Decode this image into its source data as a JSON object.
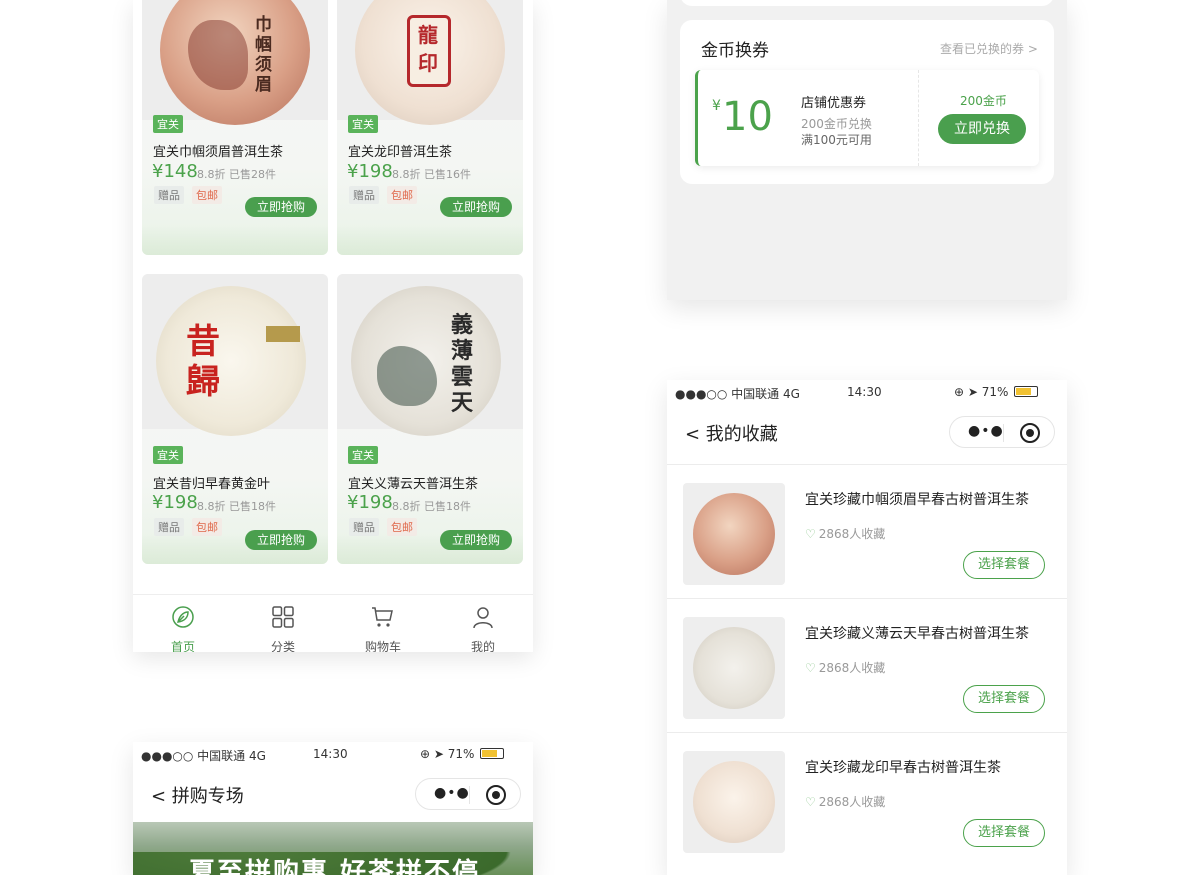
{
  "accent": "#4ba24b",
  "product_grid": {
    "products": [
      {
        "brand": "宜关",
        "name": "宜关巾帼须眉普洱生茶",
        "price": "¥148",
        "meta": "8.8折 已售28件",
        "gift": "赠品",
        "ship": "包邮",
        "buy": "立即抢购",
        "art": "巾帼须眉"
      },
      {
        "brand": "宜关",
        "name": "宜关龙印普洱生茶",
        "price": "¥198",
        "meta": "8.8折 已售16件",
        "gift": "赠品",
        "ship": "包邮",
        "buy": "立即抢购",
        "art": "龍印"
      },
      {
        "brand": "宜关",
        "name": "宜关昔归早春黄金叶",
        "price": "¥198",
        "meta": "8.8折 已售18件",
        "gift": "赠品",
        "ship": "包邮",
        "buy": "立即抢购",
        "art": "昔歸"
      },
      {
        "brand": "宜关",
        "name": "宜关义薄云天普洱生茶",
        "price": "¥198",
        "meta": "8.8折 已售18件",
        "gift": "赠品",
        "ship": "包邮",
        "buy": "立即抢购",
        "art": "義薄雲天"
      }
    ],
    "tabbar": [
      {
        "label": "首页",
        "icon": "leaf-icon",
        "active": true
      },
      {
        "label": "分类",
        "icon": "grid-icon",
        "active": false
      },
      {
        "label": "购物车",
        "icon": "cart-icon",
        "active": false
      },
      {
        "label": "我的",
        "icon": "user-icon",
        "active": false
      }
    ]
  },
  "coupon_screen": {
    "title": "金币换券",
    "view_link": "查看已兑换的券 >",
    "coupon": {
      "currency": "¥",
      "amount": "10",
      "title": "店铺优惠券",
      "cost_line": "200金币兑换",
      "condition": "满100元可用",
      "coins": "200金币",
      "redeem": "立即兑换"
    }
  },
  "status_bar": {
    "carrier": "●●●○○ 中国联通  4G",
    "time": "14:30",
    "battery": "71%"
  },
  "favorites_screen": {
    "title": "< 我的收藏",
    "items": [
      {
        "name": "宜关珍藏巾帼须眉早春古树普洱生茶",
        "count": "2868人收藏",
        "action": "选择套餐"
      },
      {
        "name": "宜关珍藏义薄云天早春古树普洱生茶",
        "count": "2868人收藏",
        "action": "选择套餐"
      },
      {
        "name": "宜关珍藏龙印早春古树普洱生茶",
        "count": "2868人收藏",
        "action": "选择套餐"
      }
    ]
  },
  "groupbuy_screen": {
    "title": "< 拼购专场",
    "banner_text": "夏至拼购惠 好茶拼不停"
  }
}
